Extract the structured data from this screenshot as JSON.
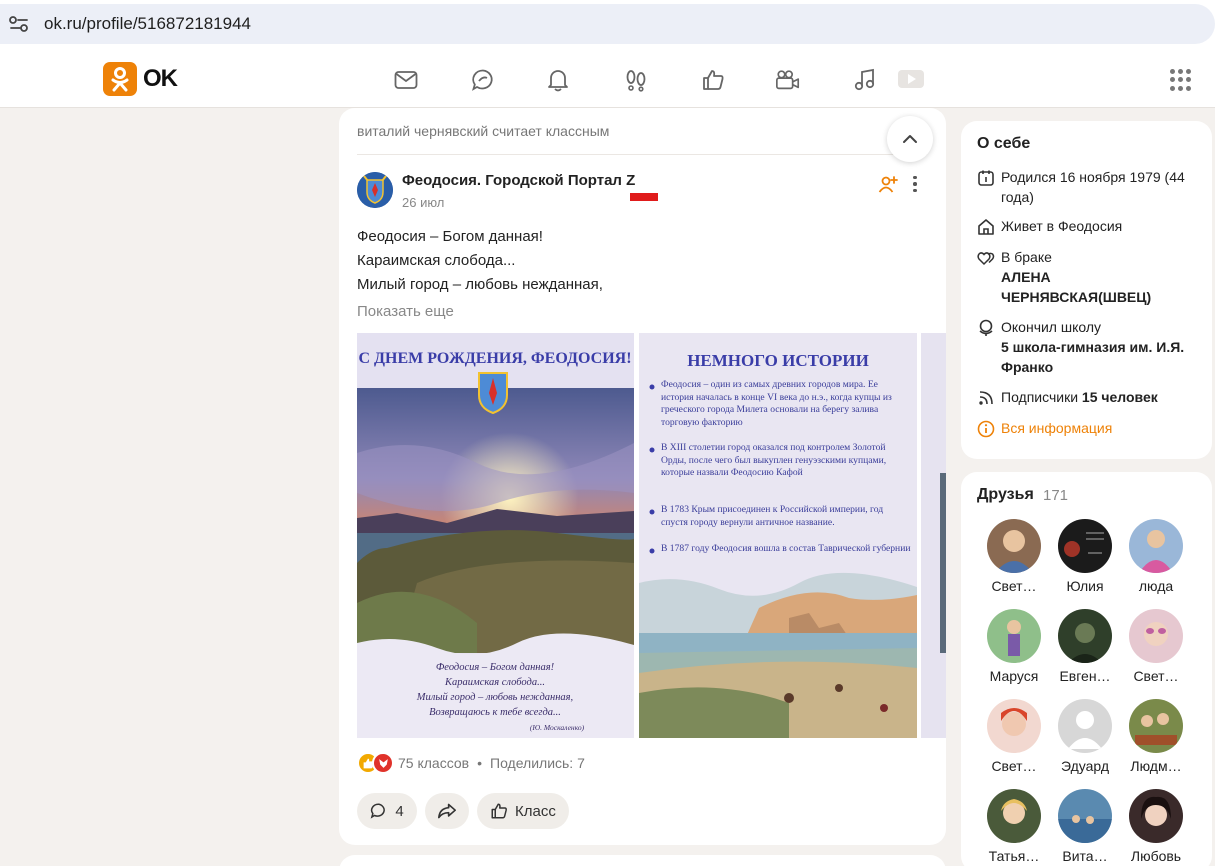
{
  "browser": {
    "url": "ok.ru/profile/516872181944"
  },
  "header": {
    "logo_text": "OK",
    "nav_icons": [
      "mail-icon",
      "chat-icon",
      "bell-icon",
      "guests-icon",
      "like-icon",
      "video-camera-icon",
      "music-icon",
      "video-icon",
      "apps-grid-icon"
    ],
    "brand_color": "#ee8208"
  },
  "feed": {
    "liker_text": "виталий чернявский считает классным",
    "post": {
      "group_name": "Феодосия. Городской Портал Z",
      "date": "26 июл",
      "lines": [
        "Феодосия – Богом данная!",
        "Караимская слобода...",
        "Милый город – любовь нежданная,"
      ],
      "show_more": "Показать еще",
      "photo1": {
        "title": "С ДНЕМ РОЖДЕНИЯ, ФЕОДОСИЯ!",
        "poem": [
          "Феодосия – Богом данная!",
          "Караимская слобода...",
          "Милый город – любовь нежданная,",
          "Возвращаюсь к тебе всегда..."
        ],
        "author": "(Ю. Москаленко)"
      },
      "photo2": {
        "title": "НЕМНОГО ИСТОРИИ",
        "bullets": [
          "Феодосия – один из самых древних городов мира. Ее история началась в конце VI века до н.э., когда купцы из греческого города Милета основали на берегу залива торговую факторию",
          "В XIII столетии город оказался под контролем Золотой Орды, после чего был выкуплен генуэзскими купцами, которые назвали Феодосию Кафой",
          "В 1783 Крым присоединен к Российской империи, год спустя городу вернули античное название.",
          "В 1787 году Феодосия вошла в состав Таврической губернии"
        ]
      },
      "reactions": {
        "classes": "75 классов",
        "separator": "•",
        "shared": "Поделились: 7"
      },
      "actions": {
        "comments_count": "4",
        "like_label": "Класс"
      }
    }
  },
  "about": {
    "title": "О себе",
    "born": "Родился 16 ноября 1979 (44 года)",
    "lives": "Живет в Феодосия",
    "married_label": "В браке",
    "spouse": "АЛЕНА ЧЕРНЯВСКАЯ(ШВЕЦ)",
    "school_label": "Окончил школу",
    "school": "5 школа-гимназия им. И.Я. Франко",
    "subs_label": "Подписчики",
    "subs_count": "15 человек",
    "all_info": "Вся информация"
  },
  "friends": {
    "title": "Друзья",
    "count": "171",
    "list": [
      {
        "name": "Свет…",
        "color": "#8a6a52"
      },
      {
        "name": "Юлия",
        "color": "#1b1b1b"
      },
      {
        "name": "люда",
        "color": "#c86aa8"
      },
      {
        "name": "Маруся",
        "color": "#6c9a6a"
      },
      {
        "name": "Евген…",
        "color": "#2f3f2a"
      },
      {
        "name": "Свет…",
        "color": "#d9a8b8"
      },
      {
        "name": "Свет…",
        "color": "#d97a6a"
      },
      {
        "name": "Эдуард",
        "color": "#cfcfcf"
      },
      {
        "name": "Людм…",
        "color": "#7a8a4a"
      },
      {
        "name": "Татья…",
        "color": "#4a5a3a"
      },
      {
        "name": "Вита…",
        "color": "#5a8ab0"
      },
      {
        "name": "Любовь",
        "color": "#3a2a2a"
      }
    ]
  }
}
